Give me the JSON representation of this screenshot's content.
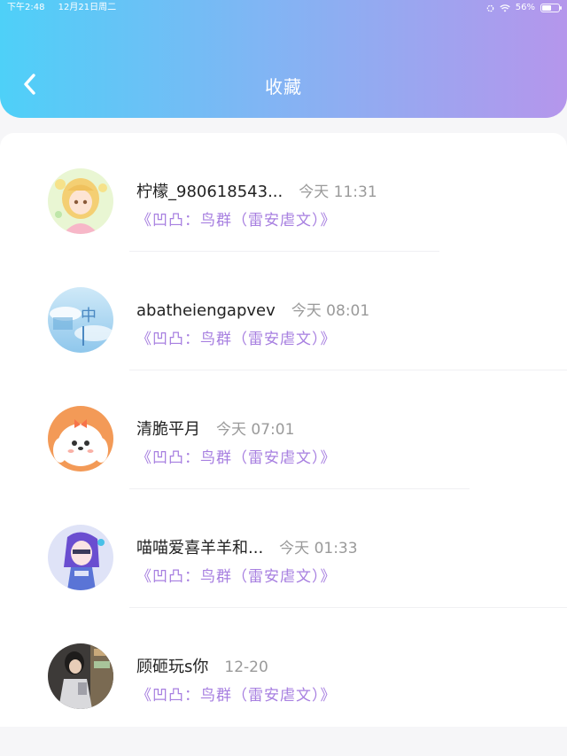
{
  "status_bar": {
    "time": "下午2:48",
    "date": "12月21日周二",
    "battery": "56%",
    "battery_level": 0.56
  },
  "header": {
    "title": "收藏"
  },
  "items": [
    {
      "name": "柠檬_980618543...",
      "time": "今天 11:31",
      "book": "《凹凸：鸟群（雷安虐文）》"
    },
    {
      "name": "abatheiengapvev",
      "time": "今天 08:01",
      "book": "《凹凸：鸟群（雷安虐文）》",
      "avatar_text": "中"
    },
    {
      "name": "清脆平月",
      "time": "今天 07:01",
      "book": "《凹凸：鸟群（雷安虐文）》"
    },
    {
      "name": "喵喵爱喜羊羊和...",
      "time": "今天 01:33",
      "book": "《凹凸：鸟群（雷安虐文）》"
    },
    {
      "name": "顾砸玩s你",
      "time": "12-20",
      "book": "《凹凸：鸟群（雷安虐文）》"
    }
  ]
}
